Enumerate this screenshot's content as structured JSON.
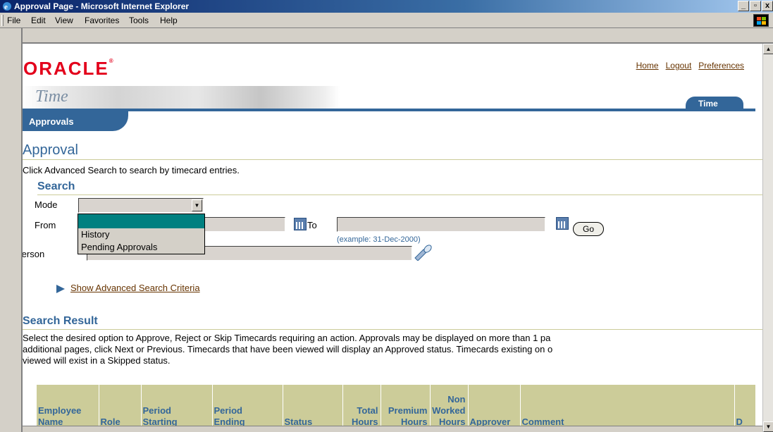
{
  "window": {
    "title": "Approval Page - Microsoft Internet Explorer",
    "min": "_",
    "max": "▫",
    "close": "x"
  },
  "menu": [
    "File",
    "Edit",
    "View",
    "Favorites",
    "Tools",
    "Help"
  ],
  "brand": {
    "logo": "ORACLE",
    "product": "Time"
  },
  "global_links": [
    "Home",
    "Logout",
    "Preferences"
  ],
  "tabs": {
    "main": "Time",
    "sub": "Approvals"
  },
  "page": {
    "title": "Approval",
    "intro": "Click Advanced Search to search by timecard entries."
  },
  "search": {
    "heading": "Search",
    "mode_label": "Mode",
    "mode_value": "",
    "mode_options": [
      "",
      "History",
      "Pending Approvals"
    ],
    "from_label": "From",
    "to_label": "To",
    "go": "Go",
    "example": "(example: 31-Dec-2000)",
    "person_label": "Person",
    "advanced_link": "Show Advanced Search Criteria"
  },
  "results": {
    "heading": "Search Result",
    "desc_lines": [
      "Select the desired option to Approve, Reject or Skip Timecards requiring an action. Approvals may be displayed on more than 1 pa",
      "additional pages, click Next or Previous. Timecards that have been viewed will display an Approved status. Timecards existing on o",
      "viewed will exist in a Skipped status."
    ],
    "columns": [
      [
        "Employee",
        "Name"
      ],
      [
        "Role"
      ],
      [
        "Period",
        "Starting"
      ],
      [
        "Period",
        "Ending"
      ],
      [
        "Status"
      ],
      [
        "Total",
        "Hours"
      ],
      [
        "Premium",
        "Hours"
      ],
      [
        "Non",
        "Worked",
        "Hours"
      ],
      [
        "Approver"
      ],
      [
        "Comment"
      ],
      [
        "D"
      ]
    ]
  },
  "colors": {
    "accent": "#336699",
    "brand_red": "#e3001b",
    "link": "#663300",
    "table_header": "#cccc99"
  }
}
